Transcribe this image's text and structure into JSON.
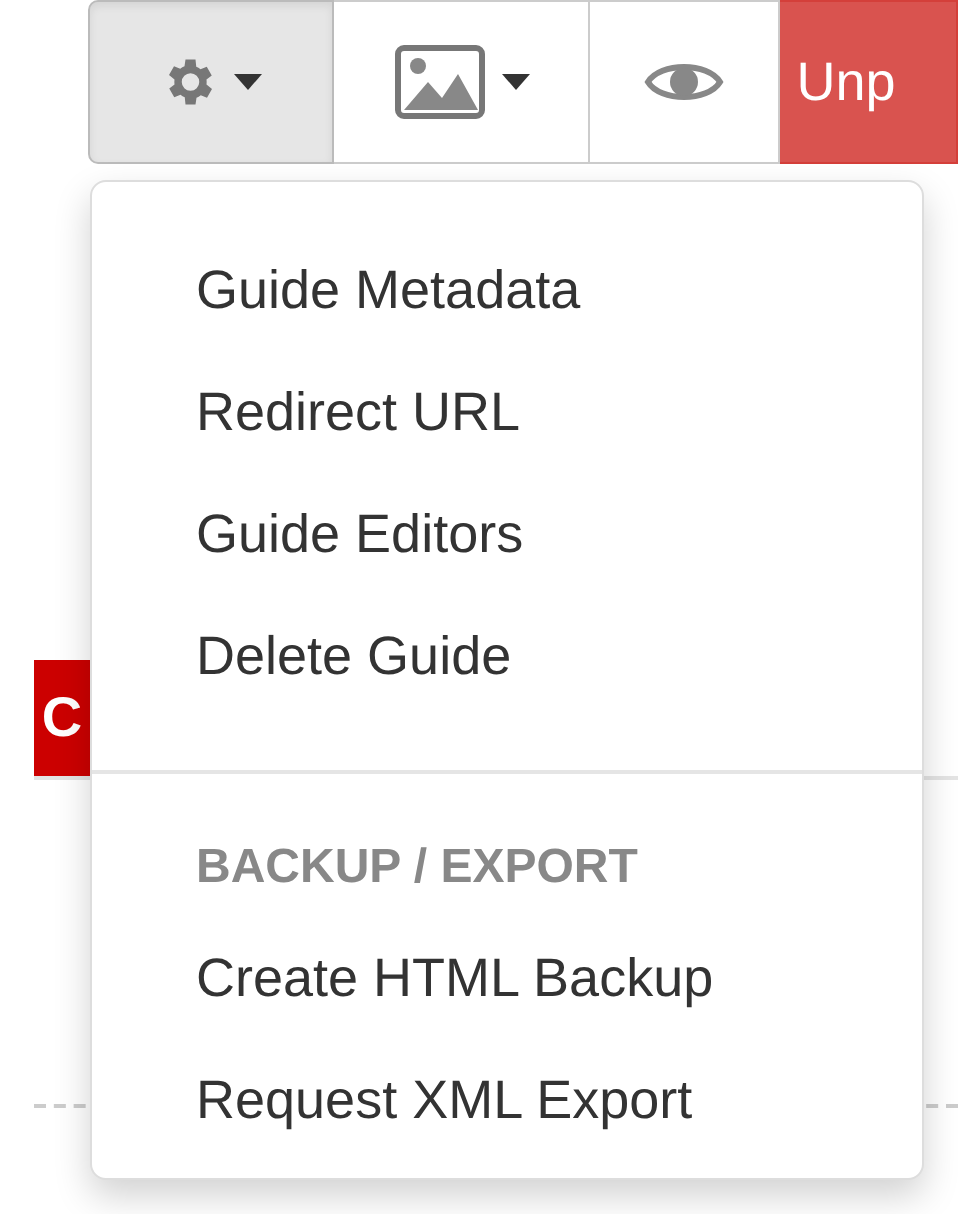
{
  "toolbar": [
    {
      "kind": "gear",
      "selected": true
    },
    {
      "kind": "image",
      "selected": false
    },
    {
      "kind": "eye",
      "selected": false
    },
    {
      "kind": "label",
      "label": "Unp",
      "selected": false
    }
  ],
  "background": {
    "badge": "C"
  },
  "menu": [
    {
      "kind": "item",
      "label": "Guide Metadata"
    },
    {
      "kind": "item",
      "label": "Redirect URL"
    },
    {
      "kind": "item",
      "label": "Guide Editors"
    },
    {
      "kind": "item",
      "label": "Delete Guide"
    },
    {
      "kind": "divider"
    },
    {
      "kind": "header",
      "label": "BACKUP / EXPORT"
    },
    {
      "kind": "item",
      "label": "Create HTML Backup"
    },
    {
      "kind": "item",
      "label": "Request XML Export"
    }
  ]
}
